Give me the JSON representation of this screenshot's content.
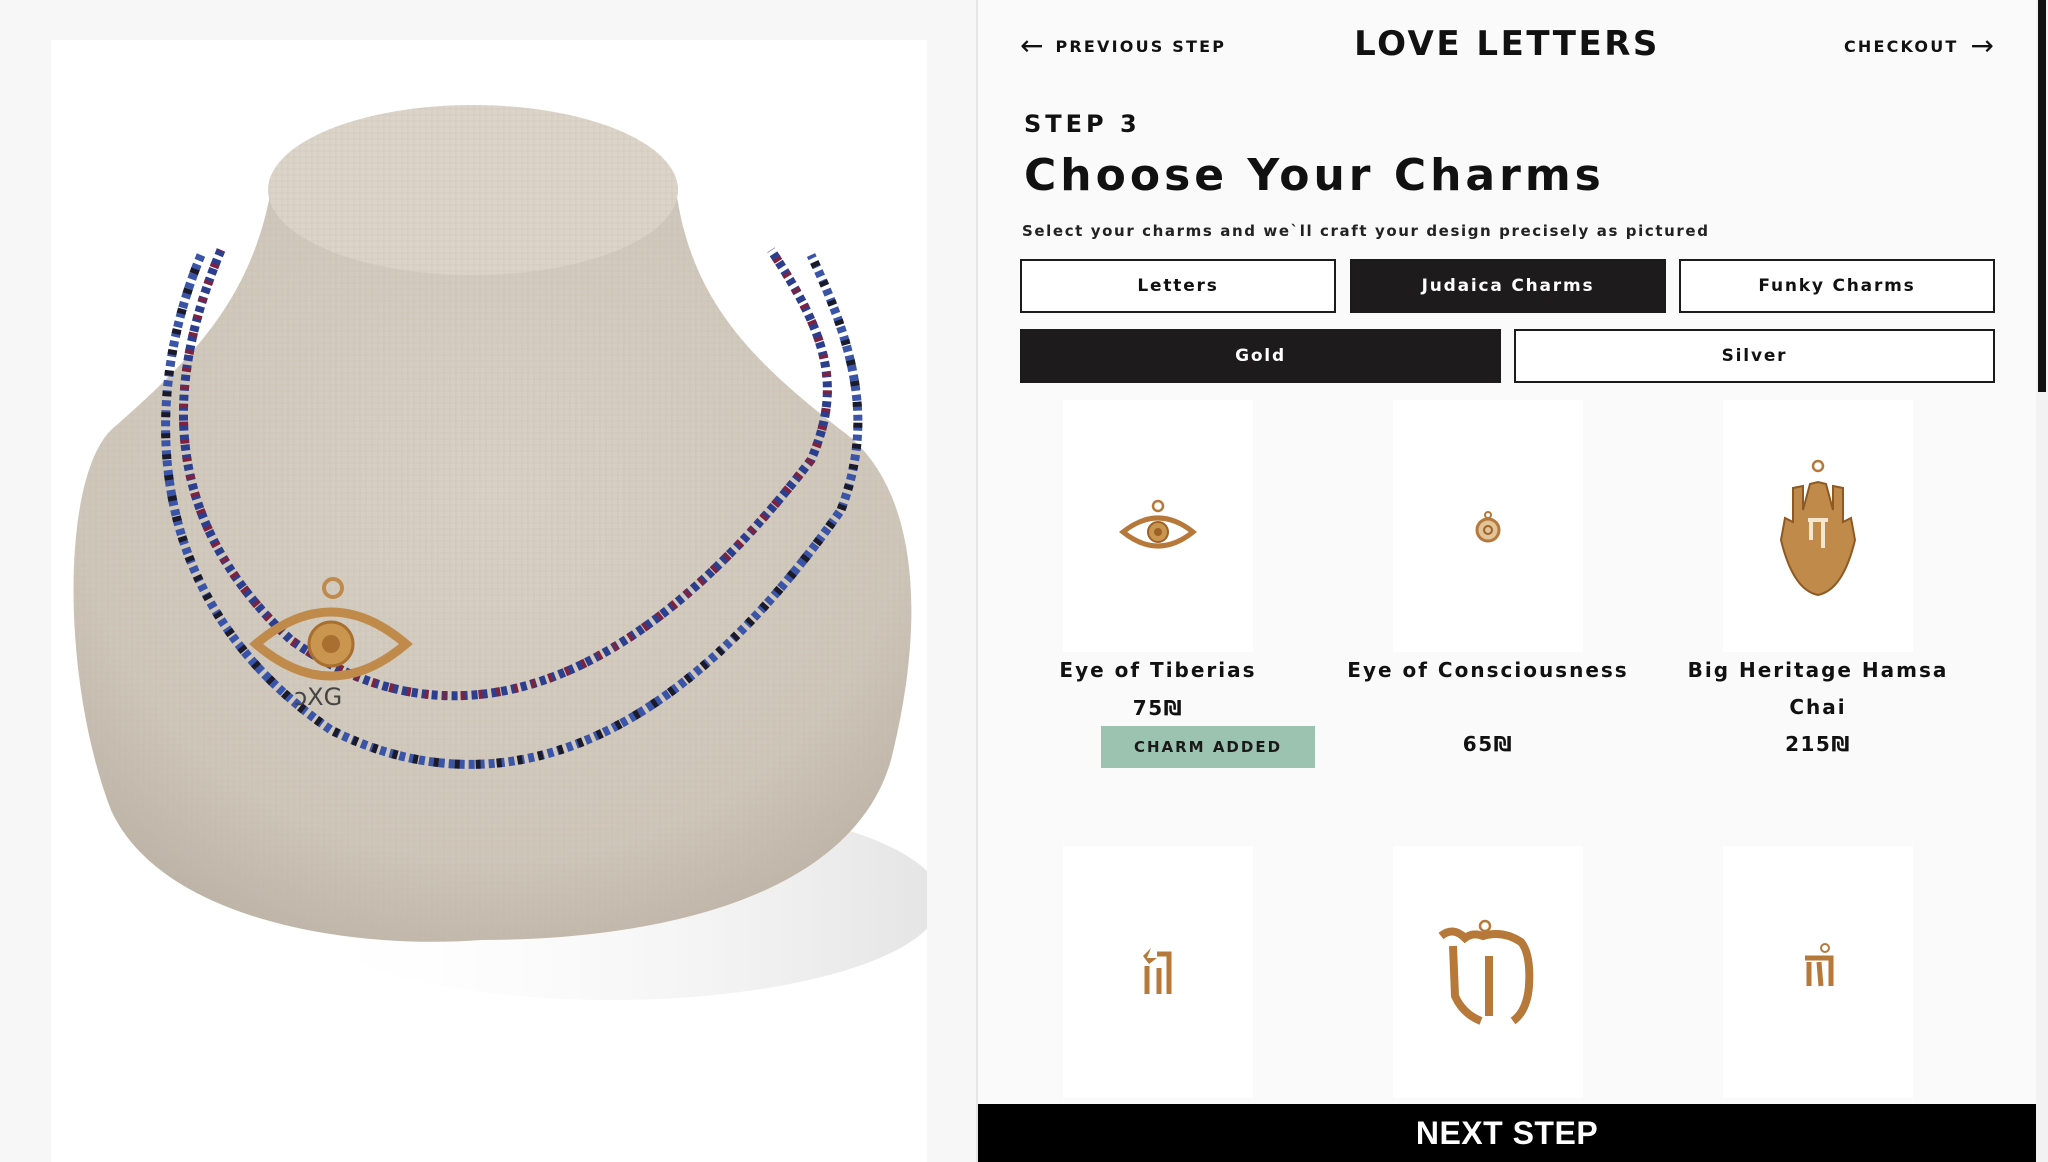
{
  "nav": {
    "previous_label": "PREVIOUS STEP",
    "checkout_label": "CHECKOUT",
    "brand": "LOVE LETTERS"
  },
  "step": {
    "label": "STEP 3",
    "title": "Choose Your Charms",
    "subtitle": "Select your charms and we`ll craft your design precisely as pictured"
  },
  "category_tabs": [
    {
      "label": "Letters",
      "active": false
    },
    {
      "label": "Judaica Charms",
      "active": true
    },
    {
      "label": "Funky Charms",
      "active": false
    }
  ],
  "metal_tabs": [
    {
      "label": "Gold",
      "active": true
    },
    {
      "label": "Silver",
      "active": false
    }
  ],
  "charms": [
    {
      "name": "Eye of Tiberias",
      "price": "75₪",
      "status": "CHARM ADDED",
      "icon": "eye-charm-icon"
    },
    {
      "name": "Eye of Consciousness",
      "price": "65₪",
      "icon": "small-eye-charm-icon"
    },
    {
      "name": "Big Heritage Hamsa Chai",
      "price": "215₪",
      "icon": "hamsa-charm-icon"
    },
    {
      "name": "",
      "price": "",
      "icon": "star-chai-charm-icon"
    },
    {
      "name": "",
      "price": "",
      "icon": "big-chai-charm-icon"
    },
    {
      "name": "",
      "price": "",
      "icon": "small-chai-charm-icon"
    }
  ],
  "preview": {
    "watermark": "ↄXG"
  },
  "footer": {
    "next_label": "NEXT STEP"
  },
  "colors": {
    "accent_dark": "#1d1b1c",
    "added_badge": "#9cc2b0",
    "gold": "#c08a4a"
  }
}
